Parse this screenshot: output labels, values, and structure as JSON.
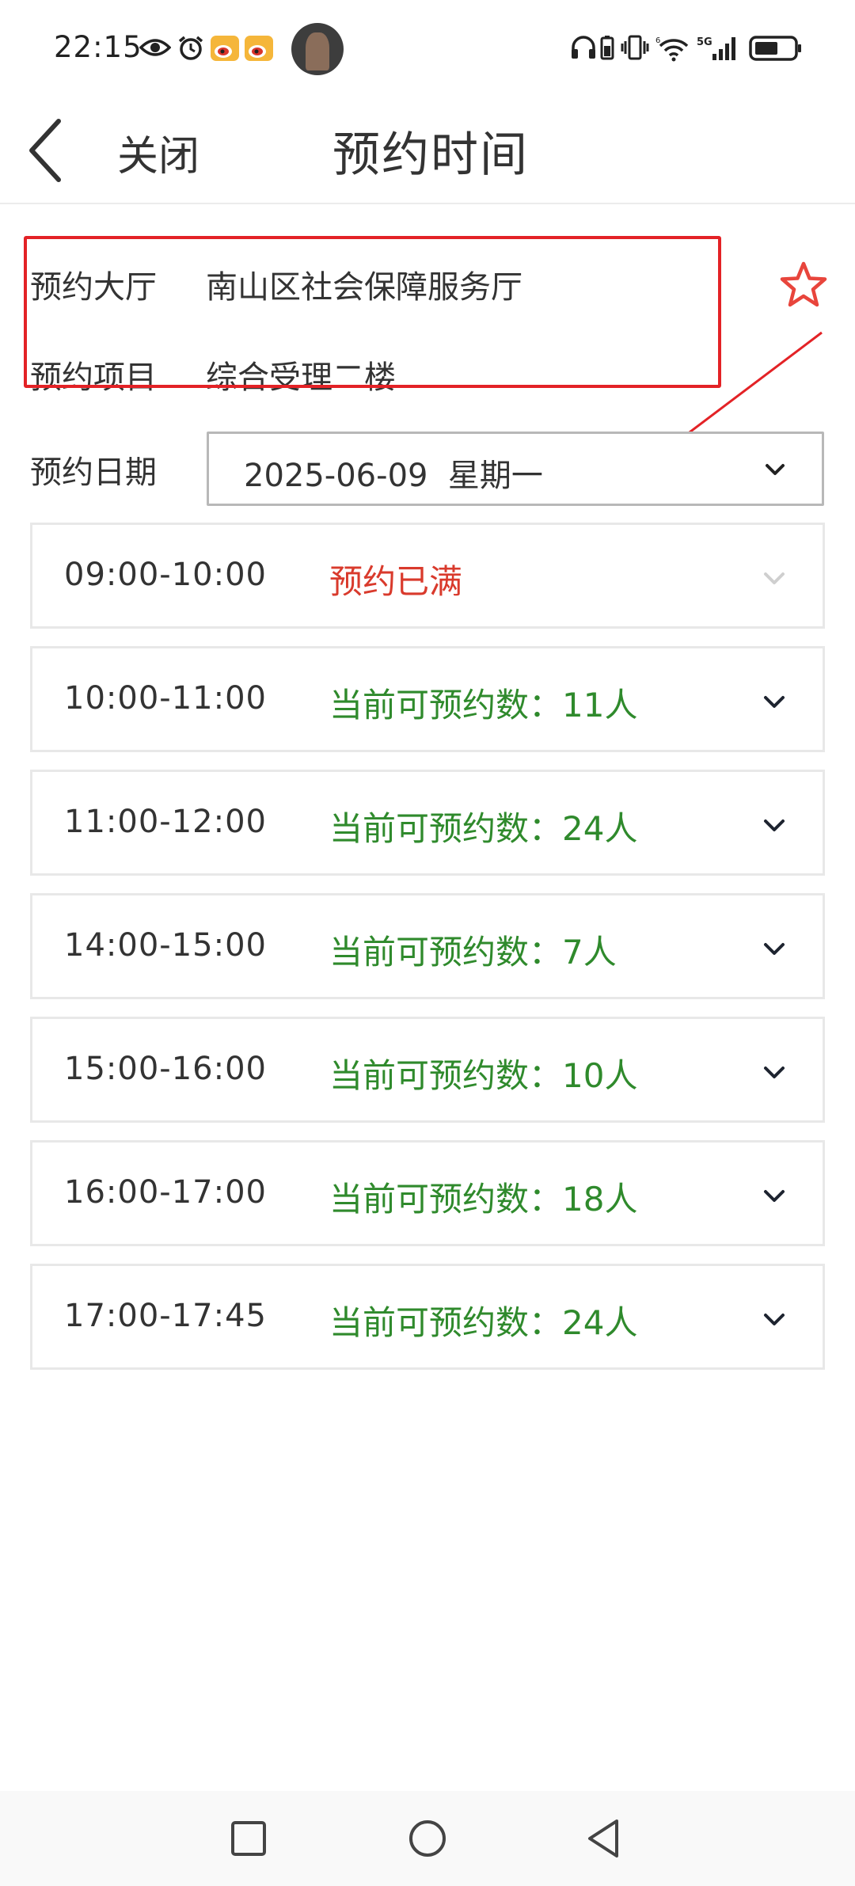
{
  "status_bar": {
    "time": "22:15",
    "icons": [
      "eye-icon",
      "alarm-icon",
      "weibo-icon",
      "weibo-icon",
      "headphones-icon",
      "battery-saver-icon",
      "vibrate-icon",
      "wifi-icon",
      "signal-5g-icon",
      "battery-icon"
    ],
    "network_label": "5G"
  },
  "header": {
    "back_icon": "chevron-left-icon",
    "close_label": "关闭",
    "title": "预约时间"
  },
  "info": {
    "hall_label": "预约大厅",
    "hall_value": "南山区社会保障服务厅",
    "item_label": "预约项目",
    "item_value": "综合受理二楼",
    "favorite_icon": "star-outline-icon"
  },
  "date": {
    "label": "预约日期",
    "value": "2025-06-09  星期一",
    "icon": "chevron-down-icon"
  },
  "slots": [
    {
      "time": "09:00-10:00",
      "status": "预约已满",
      "full": true
    },
    {
      "time": "10:00-11:00",
      "status": "当前可预约数：11人",
      "full": false
    },
    {
      "time": "11:00-12:00",
      "status": "当前可预约数：24人",
      "full": false
    },
    {
      "time": "14:00-15:00",
      "status": "当前可预约数：7人",
      "full": false
    },
    {
      "time": "15:00-16:00",
      "status": "当前可预约数：10人",
      "full": false
    },
    {
      "time": "16:00-17:00",
      "status": "当前可预约数：18人",
      "full": false
    },
    {
      "time": "17:00-17:45",
      "status": "当前可预约数：24人",
      "full": false
    }
  ],
  "colors": {
    "available": "#2f8a2c",
    "full": "#d93a2c",
    "annotation": "#e32226",
    "star": "#e8453c"
  },
  "navbar": {
    "icons": [
      "recents-square-icon",
      "home-circle-icon",
      "back-triangle-icon"
    ]
  }
}
